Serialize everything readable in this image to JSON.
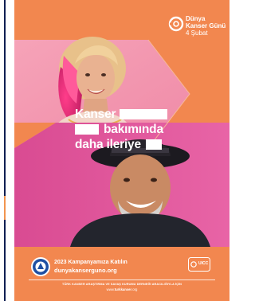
{
  "logo": {
    "title_line1": "Dünya",
    "title_line2": "Kanser Günü",
    "date": "4 Şubat"
  },
  "headline": {
    "line1_word": "Kanser",
    "line2_word": "bakımında",
    "line3_word": "daha ileriye"
  },
  "footer": {
    "campaign_title": "2023 Kampanyamıza Katılın",
    "campaign_url": "dunyakanserguno.org",
    "association": "TÜRK KANSER ARAŞTIRMA VE SAVAŞ KURUMU DERNEĞİ ARACILIĞIYLA İÇİN",
    "site_prefix": "www.",
    "site_bold": "turkkanser",
    "site_suffix": ".org",
    "uicc_label": "UICC"
  },
  "colors": {
    "brand_orange": "#f2874f",
    "pink": "#e45b9e",
    "navy": "#0f1e52"
  }
}
